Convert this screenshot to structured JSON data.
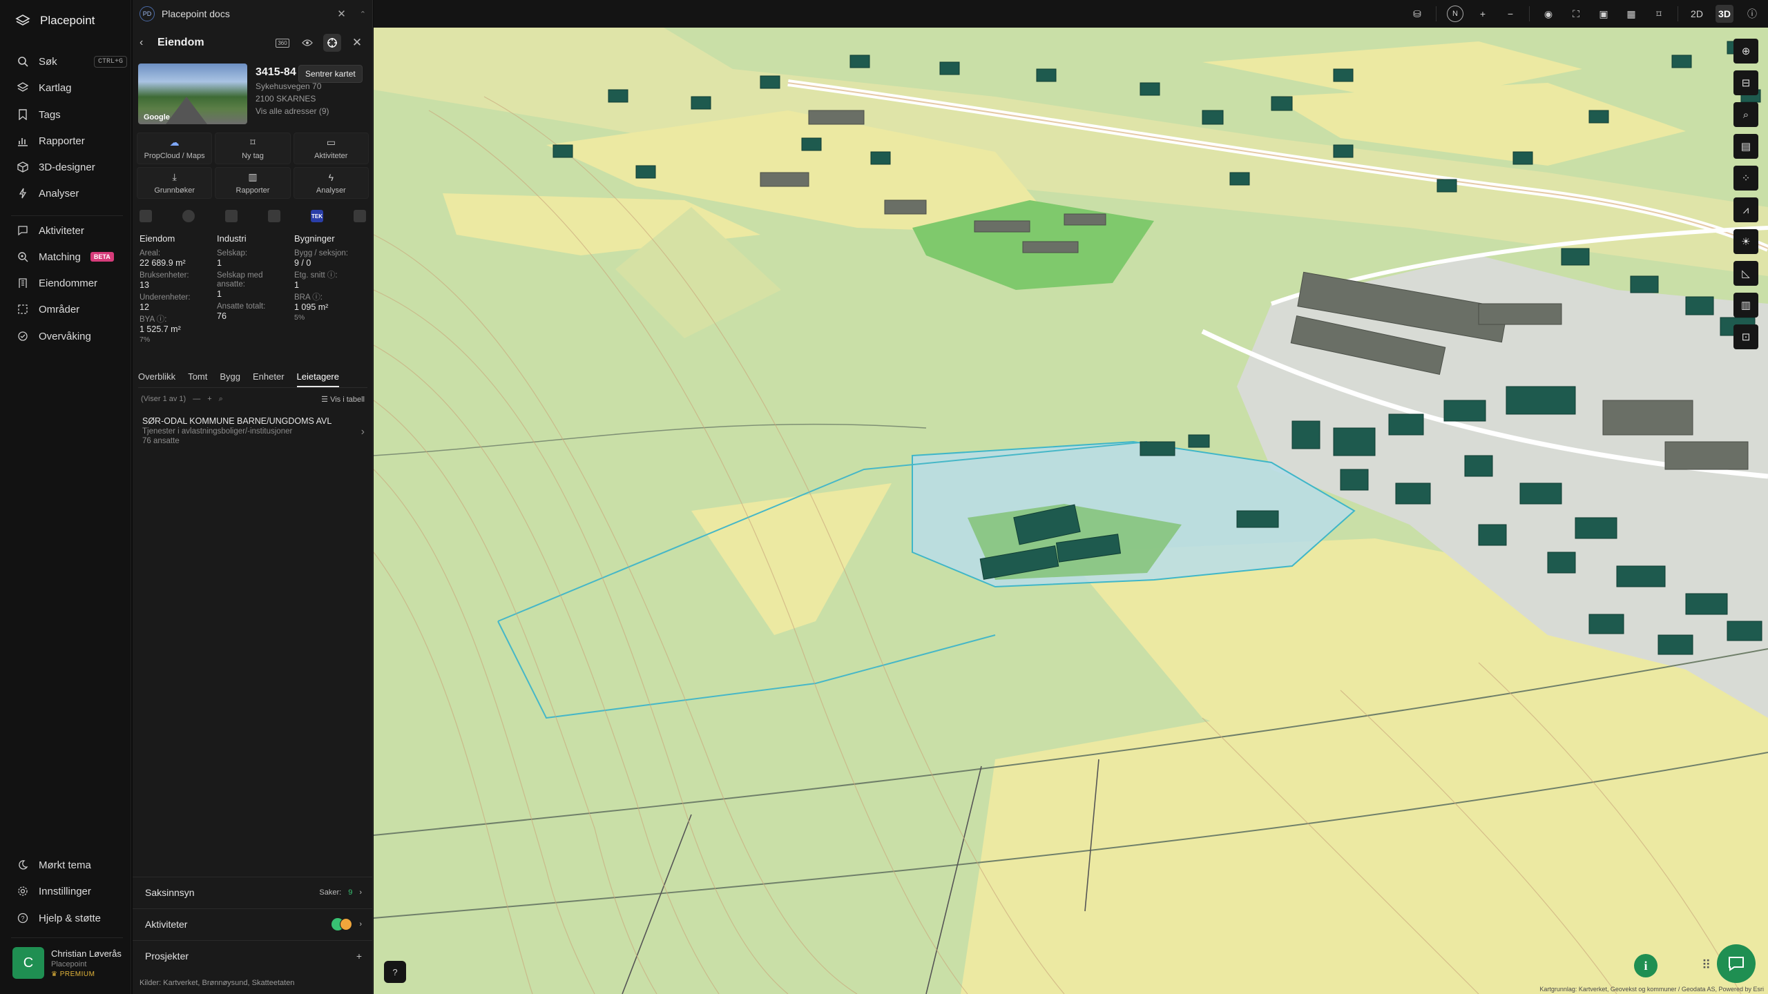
{
  "app": {
    "name": "Placepoint"
  },
  "nav": {
    "search": {
      "label": "Søk",
      "shortcut": "CTRL+G"
    },
    "items_top": [
      "Kartlag",
      "Tags",
      "Rapporter",
      "3D-designer",
      "Analyser"
    ],
    "items_mid": [
      "Aktiviteter",
      "Matching",
      "Eiendommer",
      "Områder",
      "Overvåking"
    ],
    "matching_badge": "BETA",
    "items_bottom": [
      "Mørkt tema",
      "Innstillinger",
      "Hjelp & støtte"
    ],
    "user": {
      "initial": "C",
      "name": "Christian Løverås",
      "org": "Placepoint",
      "plan": "PREMIUM"
    }
  },
  "panel": {
    "doc_tab": {
      "badge": "PD",
      "title": "Placepoint docs"
    },
    "header": {
      "title": "Eiendom",
      "badge_360": "360",
      "tooltip": "Sentrer kartet"
    },
    "property": {
      "number": "3415-84",
      "street": "Sykehusvegen 70",
      "city": "2100 SKARNES",
      "all_addresses": "Vis alle adresser (9)",
      "photo_label": "Google"
    },
    "actions": [
      "PropCloud / Maps",
      "Ny tag",
      "Aktiviteter",
      "Grunnbøker",
      "Rapporter",
      "Analyser"
    ],
    "tek_label": "TEK",
    "stats": {
      "eiendom": {
        "heading": "Eiendom",
        "areal_label": "Areal:",
        "areal_value": "22 689.9 m²",
        "bruks_label": "Bruksenheter:",
        "bruks_value": "13",
        "under_label": "Underenheter:",
        "under_value": "12",
        "bya_label": "BYA ⓘ:",
        "bya_value": "1 525.7 m²",
        "bya_pct": "7%"
      },
      "industri": {
        "heading": "Industri",
        "selskap_label": "Selskap:",
        "selskap_value": "1",
        "ansatte_label": "Selskap med ansatte:",
        "ansatte_value": "1",
        "total_label": "Ansatte totalt:",
        "total_value": "76"
      },
      "bygninger": {
        "heading": "Bygninger",
        "bygg_label": "Bygg / seksjon:",
        "bygg_value": "9 / 0",
        "etg_label": "Etg. snitt ⓘ:",
        "etg_value": "1",
        "bra_label": "BRA ⓘ:",
        "bra_value": "1 095 m²",
        "bra_pct": "5%"
      }
    },
    "tabs": [
      "Overblikk",
      "Tomt",
      "Bygg",
      "Enheter",
      "Leietagere"
    ],
    "list": {
      "count": "(Viser 1 av 1)",
      "view_table": "Vis i tabell"
    },
    "tenant": {
      "name": "SØR-ODAL KOMMUNE BARNE/UNGDOMS AVL",
      "desc": "Tjenester i avlastningsboliger/-institusjoner",
      "employees": "76 ansatte"
    },
    "sections": {
      "saksinnsyn": {
        "label": "Saksinnsyn",
        "count_label": "Saker:",
        "count_value": "9"
      },
      "aktiviteter": {
        "label": "Aktiviteter"
      },
      "prosjekter": {
        "label": "Prosjekter"
      }
    },
    "sources": {
      "label": "Kilder:",
      "items": [
        "Kartverket,",
        "Brønnøysund,",
        "Skatteetaten"
      ]
    }
  },
  "map": {
    "view_2d": "2D",
    "view_3d": "3D",
    "compass": "N",
    "attribution": "Kartgrunnlag: Kartverket, Geovekst og kommuner / Geodata AS, Powered by Esri",
    "colors": {
      "field_yellow": "#eeeaa0",
      "field_green": "#c7df9f",
      "sport_green": "#79c86e",
      "buildings": "#1e5a4e",
      "road": "#ffffff"
    }
  }
}
